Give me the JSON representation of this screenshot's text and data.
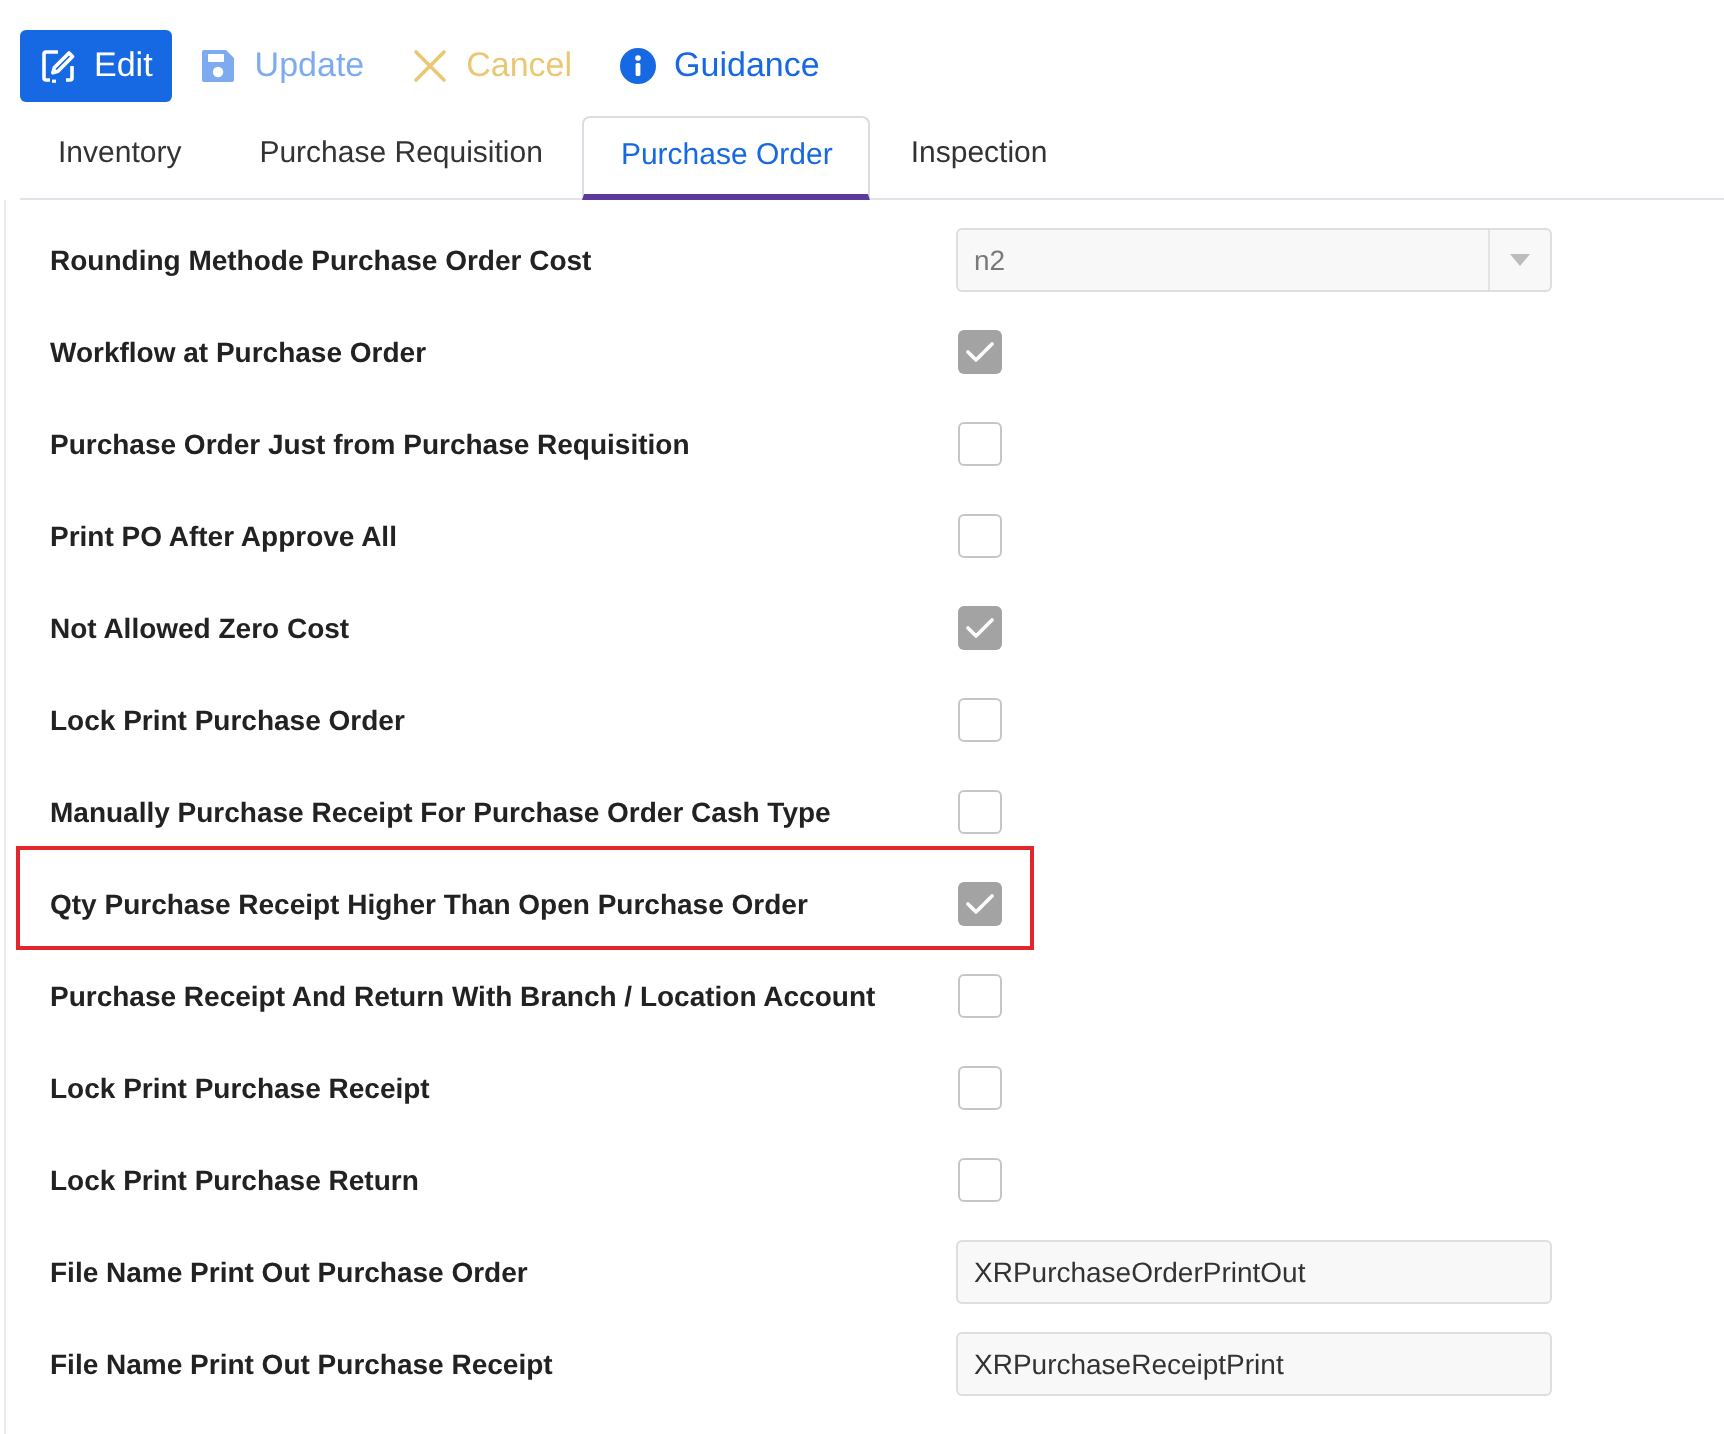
{
  "toolbar": [
    {
      "kind": "edit",
      "label": "Edit",
      "disabled": false
    },
    {
      "kind": "save",
      "label": "Update",
      "disabled": true
    },
    {
      "kind": "cancel",
      "label": "Cancel",
      "disabled": true
    },
    {
      "kind": "info",
      "label": "Guidance",
      "disabled": false
    }
  ],
  "tabs": [
    {
      "label": "Inventory",
      "selected": false
    },
    {
      "label": "Purchase Requisition",
      "selected": false
    },
    {
      "label": "Purchase Order",
      "selected": true
    },
    {
      "label": "Inspection",
      "selected": false
    }
  ],
  "settings": [
    {
      "label": "Rounding Methode Purchase Order Cost",
      "kind": "select",
      "value": "n2",
      "highlighted": false
    },
    {
      "label": "Workflow at Purchase Order",
      "kind": "checkbox",
      "checked": true,
      "highlighted": false
    },
    {
      "label": "Purchase Order Just from Purchase Requisition",
      "kind": "checkbox",
      "checked": false,
      "highlighted": false
    },
    {
      "label": "Print PO After Approve All",
      "kind": "checkbox",
      "checked": false,
      "highlighted": false
    },
    {
      "label": "Not Allowed Zero Cost",
      "kind": "checkbox",
      "checked": true,
      "highlighted": false
    },
    {
      "label": "Lock Print Purchase Order",
      "kind": "checkbox",
      "checked": false,
      "highlighted": false
    },
    {
      "label": "Manually Purchase Receipt For Purchase Order Cash Type",
      "kind": "checkbox",
      "checked": false,
      "highlighted": false
    },
    {
      "label": "Qty Purchase Receipt Higher Than Open Purchase Order",
      "kind": "checkbox",
      "checked": true,
      "highlighted": true
    },
    {
      "label": "Purchase Receipt And Return With Branch / Location Account",
      "kind": "checkbox",
      "checked": false,
      "highlighted": false
    },
    {
      "label": "Lock Print Purchase Receipt",
      "kind": "checkbox",
      "checked": false,
      "highlighted": false
    },
    {
      "label": "Lock Print Purchase Return",
      "kind": "checkbox",
      "checked": false,
      "highlighted": false
    },
    {
      "label": "File Name Print Out Purchase Order",
      "kind": "text",
      "value": "XRPurchaseOrderPrintOut",
      "highlighted": false
    },
    {
      "label": "File Name Print Out Purchase Receipt",
      "kind": "text",
      "value": "XRPurchaseReceiptPrint",
      "highlighted": false
    }
  ]
}
